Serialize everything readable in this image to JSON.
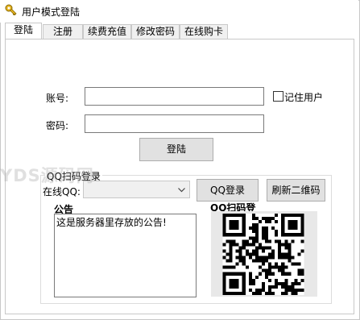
{
  "window": {
    "title": "用户模式登陆",
    "icon": "key-icon"
  },
  "tabs": [
    {
      "label": "登陆",
      "active": true
    },
    {
      "label": "注册",
      "active": false
    },
    {
      "label": "续费充值",
      "active": false
    },
    {
      "label": "修改密码",
      "active": false
    },
    {
      "label": "在线购卡",
      "active": false
    }
  ],
  "login": {
    "account_label": "账号:",
    "account_value": "",
    "remember_label": "记住用户",
    "remember_checked": false,
    "password_label": "密码:",
    "password_value": "",
    "login_button": "登陆"
  },
  "qq_group": {
    "title": "QQ扫码登录",
    "online_qq_label": "在线QQ:",
    "online_qq_value": "",
    "qq_login_button": "QQ登录",
    "refresh_qr_button": "刷新二维码",
    "qr_title": "QQ扫码登"
  },
  "notice": {
    "title": "公告",
    "text": "这是服务器里存放的公告!"
  },
  "watermark": "YDS源码网",
  "colors": {
    "button_bg": "#e1e1e1",
    "border": "#7a7a7a",
    "tab_bg": "#f0f0f0"
  }
}
